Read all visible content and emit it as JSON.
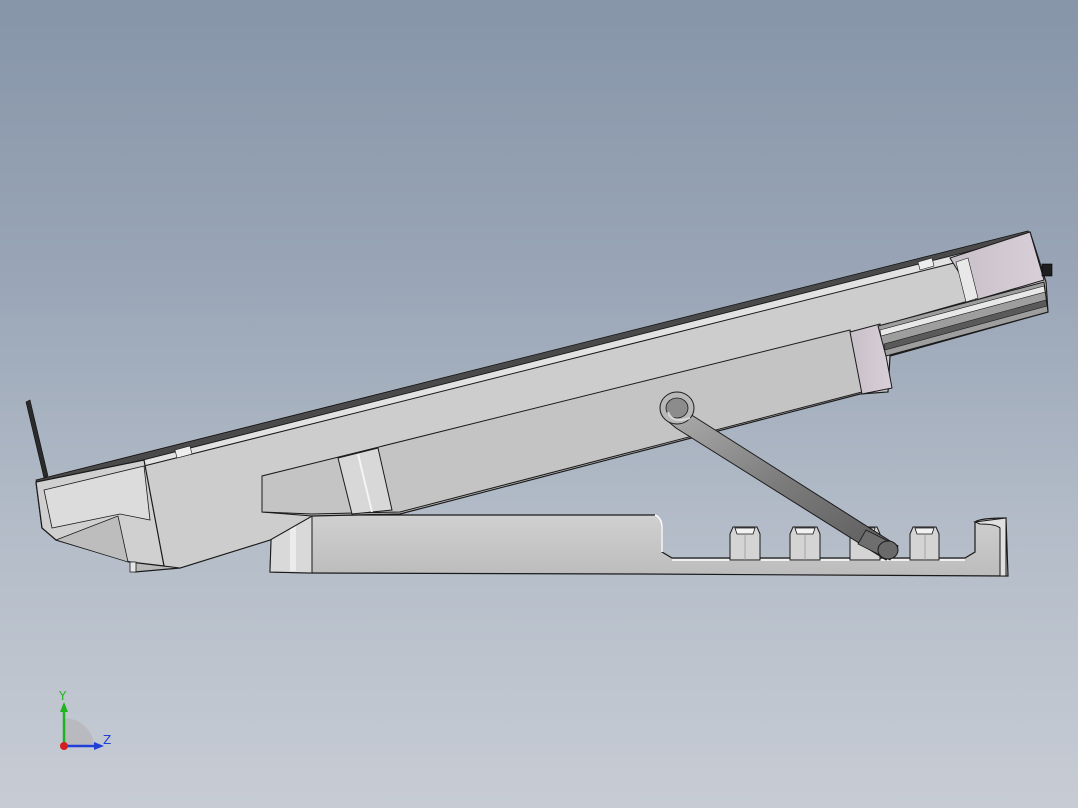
{
  "triad": {
    "y_label": "Y",
    "z_label": "Z",
    "y_color": "#1fb31f",
    "z_color": "#1f3fd8",
    "x_color": "#d41f1f"
  },
  "colors": {
    "part_face": "#c8c8c8",
    "part_edge": "#1a1a1a",
    "rod": "#8a8a8a",
    "background_top": "#8795a9",
    "background_bottom": "#c7ccd4"
  }
}
